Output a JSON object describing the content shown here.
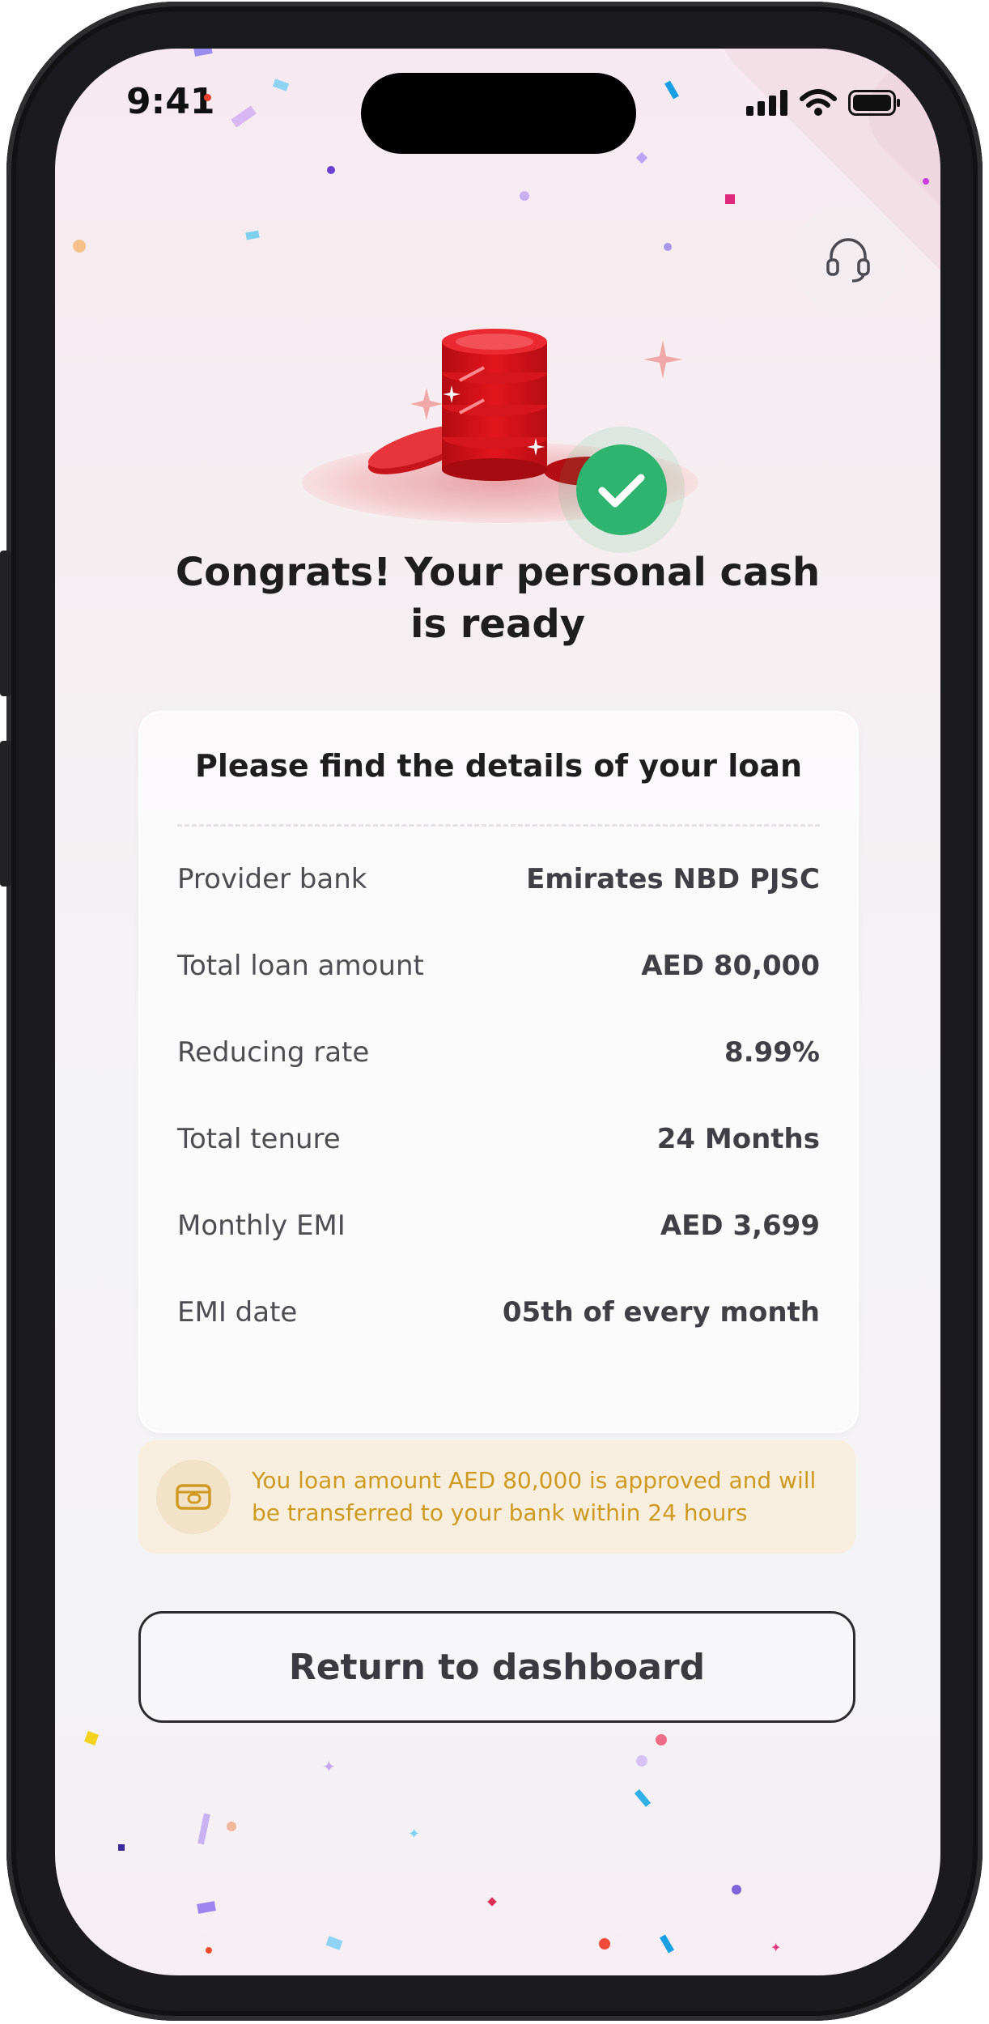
{
  "status_bar": {
    "time": "9:41"
  },
  "header": {
    "support_icon": "headset-icon"
  },
  "hero": {
    "icon": "coins-stack-with-check-icon",
    "accent": "#e0141b",
    "check_color": "#2eb46f"
  },
  "title": "Congrats! Your personal cash is ready",
  "loan_card": {
    "heading": "Please find the details of your loan",
    "rows": [
      {
        "label": "Provider bank",
        "value": "Emirates NBD PJSC"
      },
      {
        "label": "Total loan amount",
        "value": "AED 80,000"
      },
      {
        "label": "Reducing rate",
        "value": "8.99%"
      },
      {
        "label": "Total tenure",
        "value": "24 Months"
      },
      {
        "label": "Monthly EMI",
        "value": "AED 3,699"
      },
      {
        "label": "EMI date",
        "value": "05th of every month"
      }
    ]
  },
  "notice": {
    "icon": "wallet-icon",
    "text": "You loan amount AED 80,000 is approved and will be transferred to your bank within 24 hours",
    "color": "#cf9a22"
  },
  "actions": {
    "return_label": "Return to dashboard"
  }
}
